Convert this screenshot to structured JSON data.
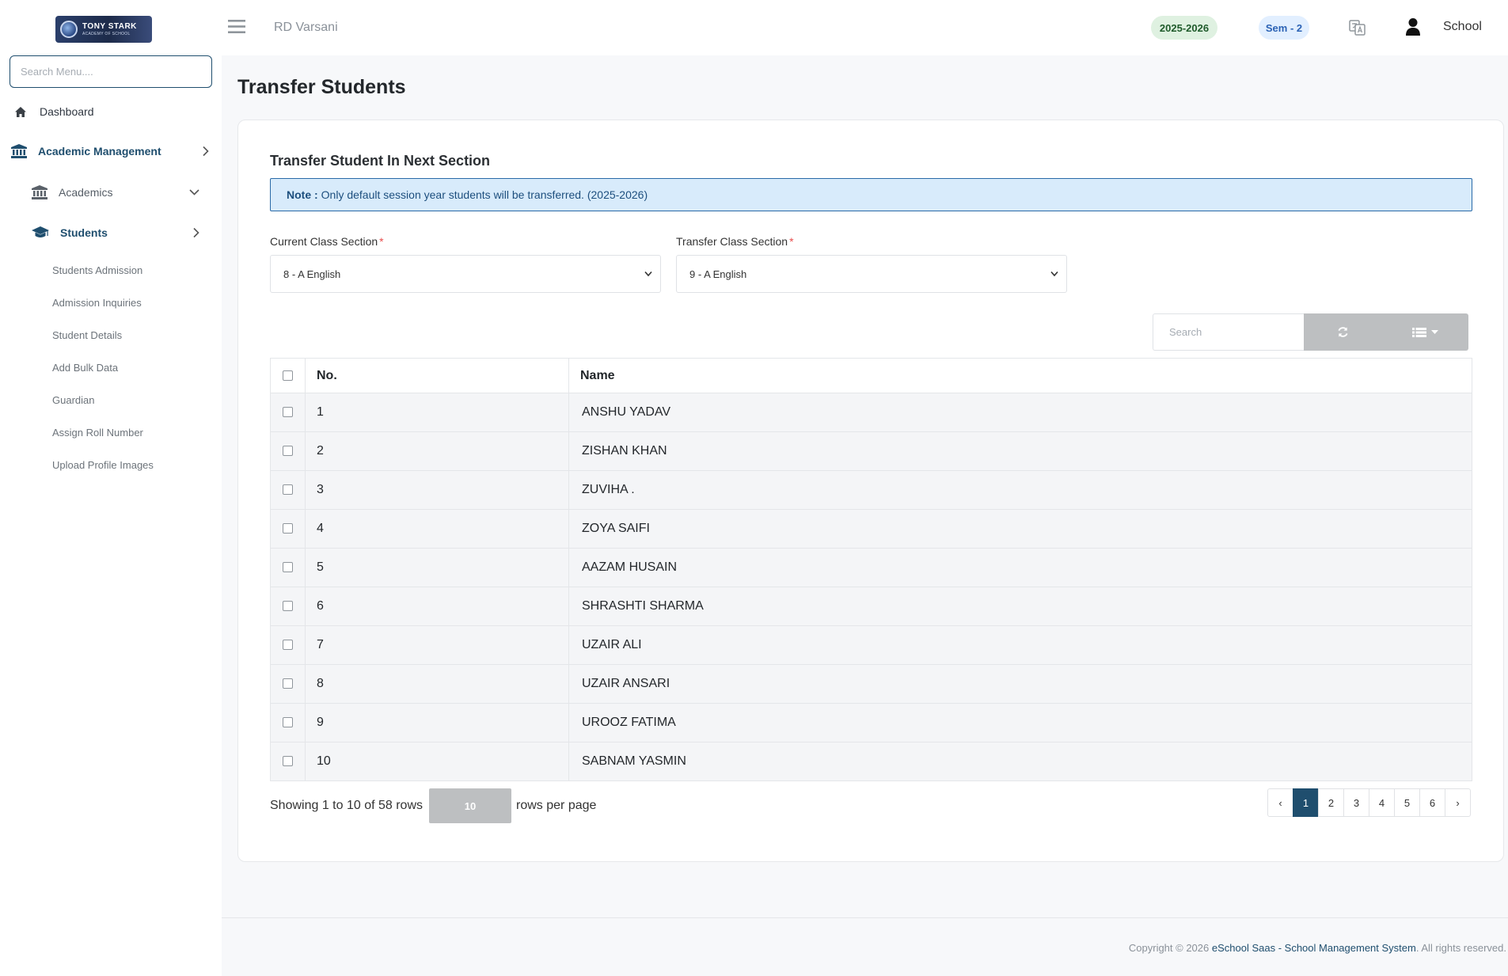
{
  "sidebar": {
    "logo": {
      "line1": "TONY STARK",
      "line2": "ACADEMY OF SCHOOL",
      "line3": ""
    },
    "search_placeholder": "Search Menu....",
    "dashboard": "Dashboard",
    "academic_management": "Academic Management",
    "academics": "Academics",
    "students": "Students",
    "student_sub_items": [
      "Students Admission",
      "Admission Inquiries",
      "Student Details",
      "Add Bulk Data",
      "Guardian",
      "Assign Roll Number",
      "Upload Profile Images"
    ]
  },
  "header": {
    "brand": "RD Varsani",
    "session_year": "2025-2026",
    "semester": "Sem - 2",
    "user_name": "School",
    "icons": [
      "hamburger-icon",
      "translate-icon",
      "user-icon"
    ]
  },
  "main": {
    "page_title": "Transfer Students",
    "card_title": "Transfer Student In Next Section",
    "note_label": "Note :",
    "note_text": "Only default session year students will be transferred. (2025-2026)",
    "current_class_label": "Current Class Section",
    "current_class_value": "8 - A English",
    "transfer_class_label": "Transfer Class Section",
    "transfer_class_value": "9 - A English",
    "required_mark": "*",
    "table_search_placeholder": "Search",
    "columns": {
      "no": "No.",
      "name": "Name"
    },
    "rows": [
      {
        "no": "1",
        "name": "ANSHU YADAV"
      },
      {
        "no": "2",
        "name": "ZISHAN KHAN"
      },
      {
        "no": "3",
        "name": "ZUVIHA ."
      },
      {
        "no": "4",
        "name": "ZOYA SAIFI"
      },
      {
        "no": "5",
        "name": "AAZAM HUSAIN"
      },
      {
        "no": "6",
        "name": "SHRASHTI SHARMA"
      },
      {
        "no": "7",
        "name": "UZAIR ALI"
      },
      {
        "no": "8",
        "name": "UZAIR ANSARI"
      },
      {
        "no": "9",
        "name": "UROOZ FATIMA"
      },
      {
        "no": "10",
        "name": "SABNAM YASMIN"
      }
    ],
    "showing_text": "Showing 1 to 10 of 58 rows",
    "rows_per_page_value": "10",
    "rows_per_page_text": "rows per page",
    "pagination": [
      "‹",
      "1",
      "2",
      "3",
      "4",
      "5",
      "6",
      "›"
    ],
    "active_page": "1"
  },
  "footer": {
    "copyright_prefix": "Copyright © 2026",
    "product": "eSchool Saas - School Management System",
    "suffix": ". All rights reserved."
  },
  "colors": {
    "primary": "#1f4e6e",
    "note_bg": "#d8ebfb",
    "year_pill_bg": "#dff1e1",
    "sem_pill_bg": "#e2efff",
    "tool_button": "#bdbfc1"
  }
}
